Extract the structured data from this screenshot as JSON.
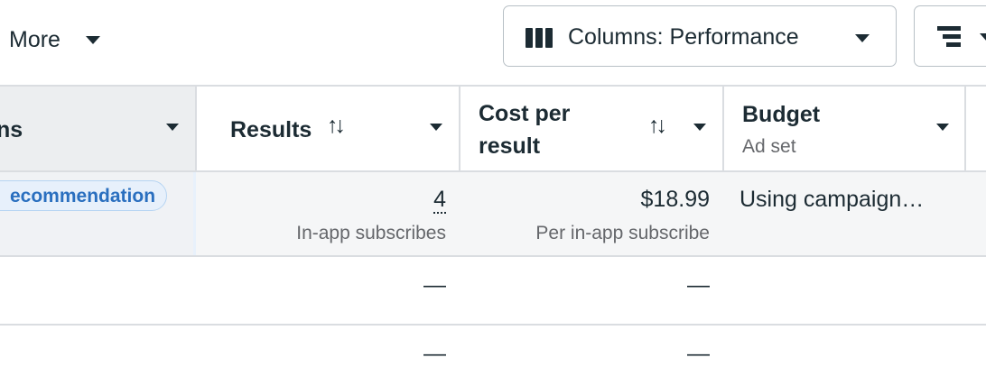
{
  "toolbar": {
    "more_label": "More",
    "columns_label": "Columns: Performance",
    "columns_icon": "columns-icon",
    "breakdown_icon": "breakdown-icon"
  },
  "table": {
    "headers": {
      "name_partial": "ns",
      "results": "Results",
      "cost_per_result_line1": "Cost per",
      "cost_per_result_line2": "result",
      "budget": "Budget",
      "budget_sub": "Ad set",
      "sort_glyph": "↑↓"
    },
    "rows": [
      {
        "badge": "ecommendation",
        "results_value": "4",
        "results_sub": "In-app subscribes",
        "cost_value": "$18.99",
        "cost_sub": "Per in-app subscribe",
        "budget_value": "Using campaign…"
      },
      {
        "results_value": "—",
        "cost_value": "—"
      },
      {
        "results_value": "—",
        "cost_value": "—"
      }
    ]
  },
  "colors": {
    "text": "#1c2b33",
    "muted": "#65676b",
    "border": "#dadde1",
    "badge_text": "#2a6fbf",
    "badge_bg": "#e7f0fb"
  }
}
